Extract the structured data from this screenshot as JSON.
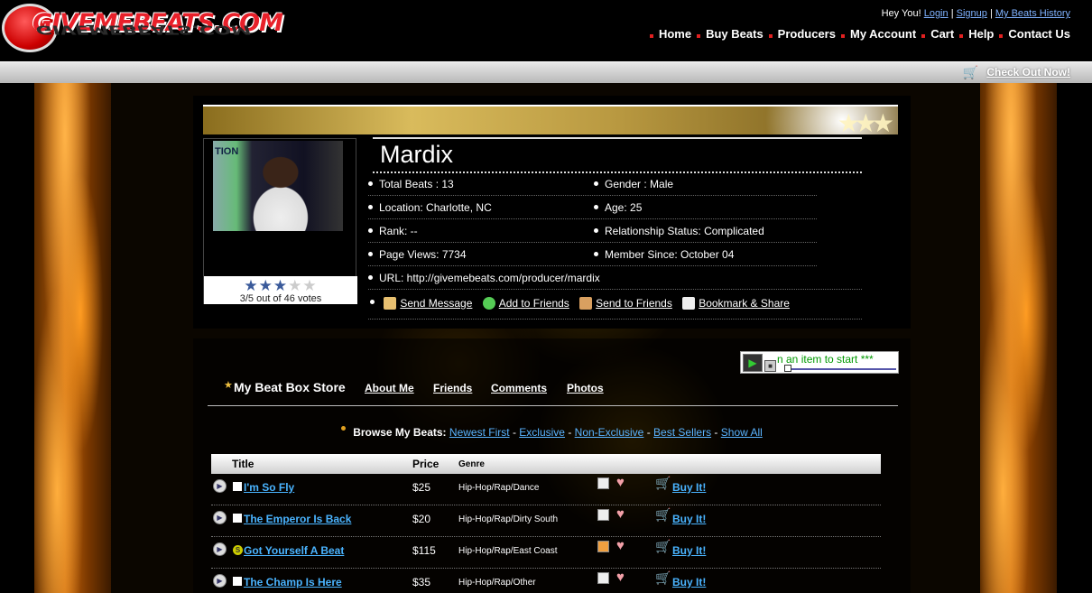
{
  "header": {
    "logo_text": "GIVEMEBEATS.COM",
    "greeting": "Hey You!",
    "login": "Login",
    "signup": "Signup",
    "history": "My Beats History",
    "sep": "|",
    "nav": [
      "Home",
      "Buy Beats",
      "Producers",
      "My Account",
      "Cart",
      "Help",
      "Contact Us"
    ]
  },
  "checkout": {
    "label": "Check Out Now!",
    "icon": "cart-icon"
  },
  "profile": {
    "name": "Mardix",
    "photo_sign": "TION",
    "rating": {
      "value": 3,
      "max": 5,
      "text": "3/5 out of 46 votes"
    },
    "info": {
      "total_beats": "Total Beats : 13",
      "gender": "Gender : Male",
      "location": "Location: Charlotte, NC",
      "age": "Age: 25",
      "rank": "Rank: --",
      "relationship": "Relationship Status: Complicated",
      "page_views": "Page Views: 7734",
      "member_since": "Member Since: October 04",
      "url": "URL: http://givemebeats.com/producer/mardix"
    },
    "actions": [
      "Send Message",
      "Add to Friends",
      "Send to Friends",
      "Bookmark & Share"
    ]
  },
  "player": {
    "message": "n an item to start ***"
  },
  "tabs": {
    "main": "My Beat Box Store",
    "items": [
      "About Me",
      "Friends",
      "Comments",
      "Photos"
    ]
  },
  "browse": {
    "label": "Browse My Beats:",
    "links": [
      "Newest First",
      "Exclusive",
      "Non-Exclusive",
      "Best Sellers",
      "Show All"
    ],
    "sep": "-"
  },
  "table": {
    "headers": {
      "title": "Title",
      "price": "Price",
      "genre": "Genre"
    },
    "buy_label": "Buy It!",
    "rows": [
      {
        "title": "I'm So Fly",
        "price": "$25",
        "genre": "Hip-Hop/Rap/Dance",
        "marker": ""
      },
      {
        "title": "The Emperor Is Back",
        "price": "$20",
        "genre": "Hip-Hop/Rap/Dirty South",
        "marker": ""
      },
      {
        "title": "Got Yourself A Beat",
        "price": "$115",
        "genre": "Hip-Hop/Rap/East Coast",
        "marker": "S"
      },
      {
        "title": "The Champ Is Here",
        "price": "$35",
        "genre": "Hip-Hop/Rap/Other",
        "marker": ""
      }
    ]
  }
}
